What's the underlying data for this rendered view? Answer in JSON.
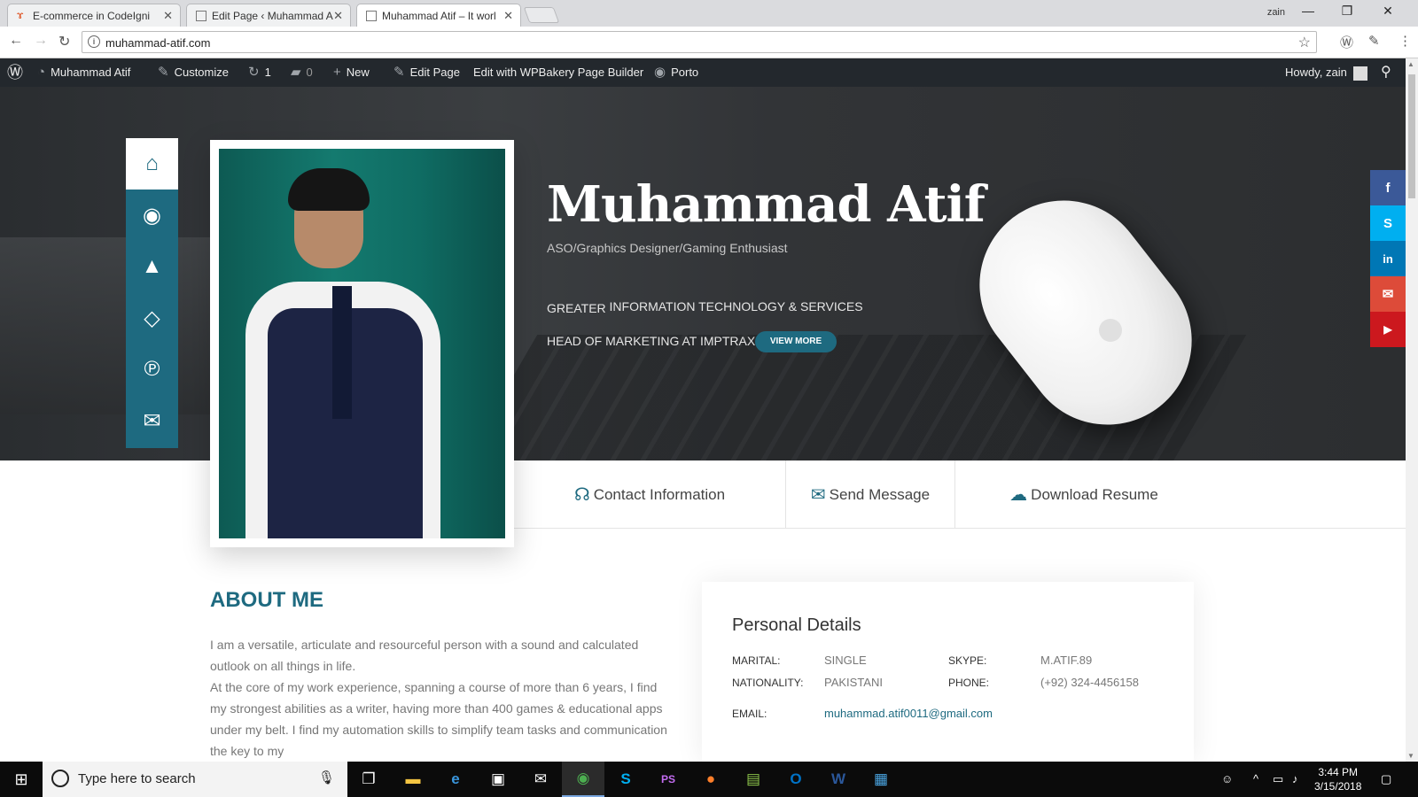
{
  "browser": {
    "tabs": [
      {
        "title": "E-commerce in CodeIgni",
        "active": false
      },
      {
        "title": "Edit Page ‹ Muhammad A",
        "active": false
      },
      {
        "title": "Muhammad Atif – It worl",
        "active": true
      }
    ],
    "window_user": "zain",
    "url": "muhammad-atif.com"
  },
  "adminbar": {
    "site_name": "Muhammad Atif",
    "customize": "Customize",
    "updates_count": "1",
    "comments_count": "0",
    "new": "New",
    "edit_page": "Edit Page",
    "wpbakery": "Edit with WPBakery Page Builder",
    "theme": "Porto",
    "howdy": "Howdy, zain"
  },
  "hero": {
    "name": "Muhammad Atif",
    "subtitle": "ASO/Graphics Designer/Gaming Enthusiast",
    "line1_prefix": "GREATER",
    "line1_rest": "INFORMATION TECHNOLOGY & SERVICES",
    "line2": "HEAD OF MARKETING AT IMPTRAX",
    "view_more": "VIEW MORE"
  },
  "side_nav": [
    {
      "icon": "home-icon",
      "glyph": "⌂",
      "active": true
    },
    {
      "icon": "eye-icon",
      "glyph": "◉",
      "active": false
    },
    {
      "icon": "graduation-cap-icon",
      "glyph": "🎓",
      "active": false
    },
    {
      "icon": "diamond-icon",
      "glyph": "◇",
      "active": false
    },
    {
      "icon": "pinterest-icon",
      "glyph": "℗",
      "active": false
    },
    {
      "icon": "envelope-open-icon",
      "glyph": "✉",
      "active": false
    }
  ],
  "social": [
    {
      "icon": "facebook-icon",
      "glyph": "f",
      "color": "#3b5998"
    },
    {
      "icon": "skype-icon",
      "glyph": "S",
      "color": "#00aff0"
    },
    {
      "icon": "linkedin-icon",
      "glyph": "in",
      "color": "#0077b5"
    },
    {
      "icon": "email-icon",
      "glyph": "✉",
      "color": "#dd4b39"
    },
    {
      "icon": "youtube-icon",
      "glyph": "▶",
      "color": "#cc181e"
    }
  ],
  "contact_bar": {
    "contact_info": "Contact Information",
    "send_message": "Send Message",
    "download_resume": "Download Resume"
  },
  "about": {
    "title": "ABOUT ME",
    "p1": "I am a versatile, articulate and resourceful person with a sound and calculated outlook on all things in life.",
    "p2": "At the core of my work experience, spanning a course of more than 6 years, I find my strongest abilities as a writer, having more than 400 games & educational apps under my belt. I find my automation skills to simplify team tasks and communication the key to my"
  },
  "personal_details": {
    "title": "Personal Details",
    "marital_label": "MARITAL:",
    "marital": "SINGLE",
    "nationality_label": "NATIONALITY:",
    "nationality": "PAKISTANI",
    "skype_label": "SKYPE:",
    "skype": "M.ATIF.89",
    "phone_label": "PHONE:",
    "phone": "(+92) 324-4456158",
    "email_label": "EMAIL:",
    "email": "muhammad.atif0011@gmail.com"
  },
  "taskbar": {
    "search_placeholder": "Type here to search",
    "time": "3:44 PM",
    "date": "3/15/2018"
  },
  "colors": {
    "accent": "#1e6a80",
    "adminbar": "#23282d"
  }
}
